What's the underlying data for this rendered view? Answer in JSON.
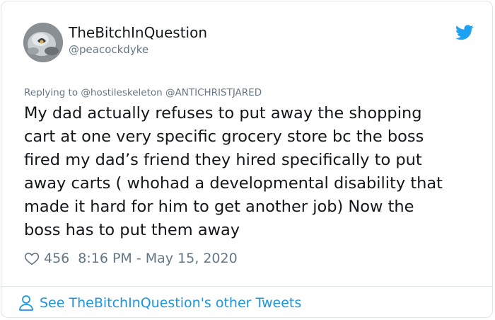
{
  "colors": {
    "twitter_blue": "#1da1f2",
    "link_blue": "#1b95e0",
    "secondary_text": "#657786",
    "primary_text": "#14171a"
  },
  "user": {
    "display_name": "TheBitchInQuestion",
    "handle": "@peacockdyke",
    "avatar_icon": "avatar-photo"
  },
  "reply": {
    "prefix": "Replying to",
    "mentions": [
      "@hostileskeleton",
      "@ANTICHRISTJARED"
    ]
  },
  "tweet": {
    "lines": [
      "My dad actually refuses to put away the shopping",
      "cart at one very specific grocery store bc the boss",
      "fired my dad’s friend they hired specifically to put",
      "away carts ( whohad a developmental disability that",
      "made it hard for him to get another job) Now the",
      "boss has to put them away"
    ]
  },
  "meta": {
    "like_icon": "heart-icon",
    "like_count": "456",
    "timestamp": "8:16 PM - May 15, 2020"
  },
  "footer": {
    "icon": "person-icon",
    "link_text": "See TheBitchInQuestion's other Tweets"
  }
}
